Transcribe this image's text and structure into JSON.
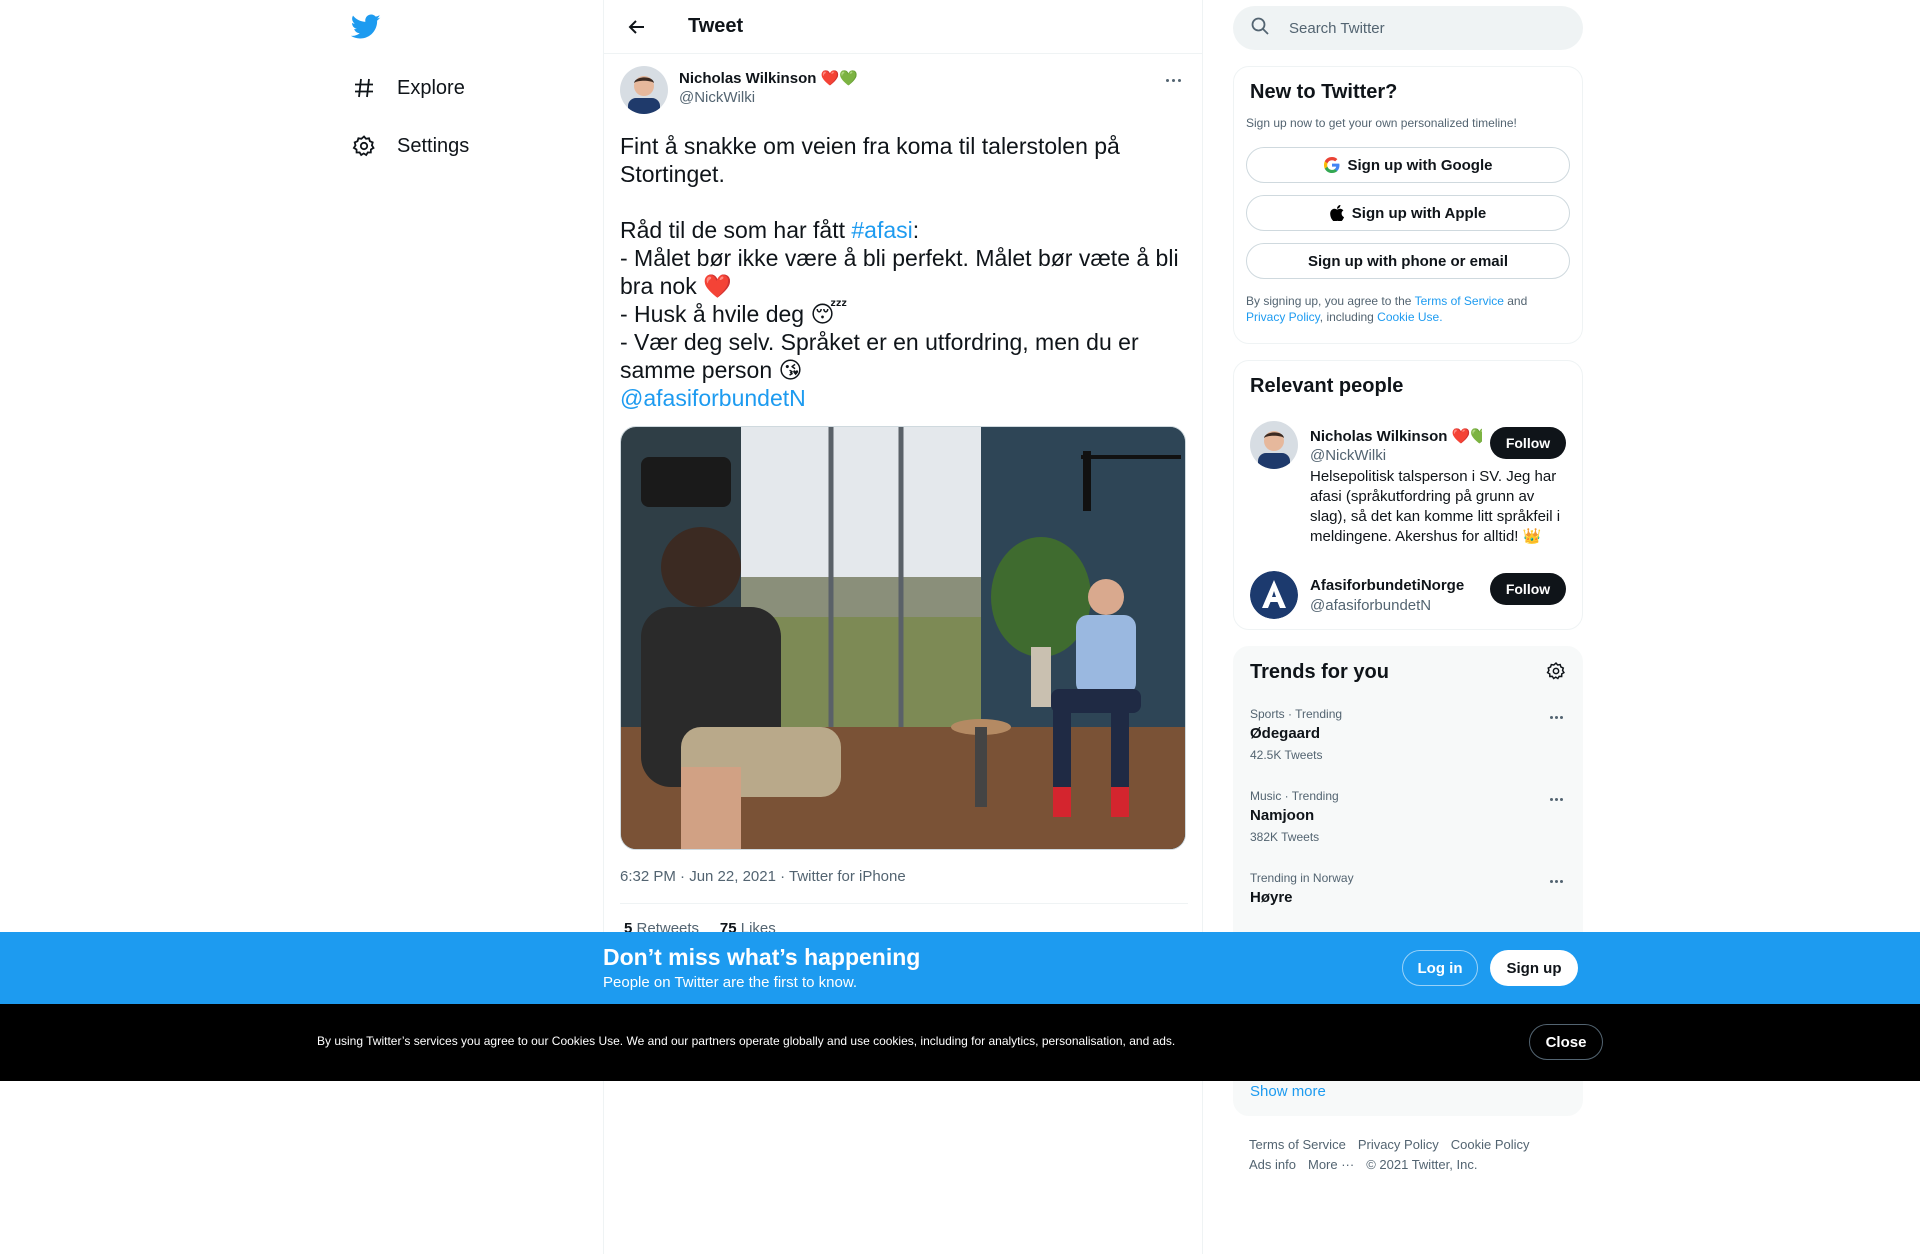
{
  "nav": {
    "items": [
      {
        "label": "Explore",
        "icon": "hashtag-icon"
      },
      {
        "label": "Settings",
        "icon": "gear-icon"
      }
    ]
  },
  "header": {
    "title": "Tweet"
  },
  "tweet": {
    "author_name": "Nicholas Wilkinson ❤️💚",
    "author_handle": "@NickWilki",
    "lines": [
      "Fint å snakke om veien fra koma til talerstolen på Stortinget.",
      "",
      "Råd til de som har fått ",
      "- Målet bør ikke være å bli perfekt. Målet bør væte å bli bra nok ❤️",
      "- Husk å hvile deg 😴",
      "- Vær deg selv. Språket er en utfordring, men du er samme person 😘"
    ],
    "hashtag": "#afasi",
    "hashtag_suffix": ":",
    "mention": "@afasiforbundetN",
    "meta": "6:32 PM · Jun 22, 2021 · Twitter for iPhone",
    "retweets_count": "5",
    "retweets_label": "Retweets",
    "likes_count": "75",
    "likes_label": "Likes"
  },
  "search": {
    "placeholder": "Search Twitter"
  },
  "new_to_twitter": {
    "title": "New to Twitter?",
    "subtitle": "Sign up now to get your own personalized timeline!",
    "google_label": "Sign up with Google",
    "apple_label": "Sign up with Apple",
    "phone_label": "Sign up with phone or email",
    "legal_1": "By signing up, you agree to the ",
    "terms_link": "Terms of Service",
    "legal_2": " and ",
    "privacy_link": "Privacy Policy",
    "legal_3": ", including ",
    "cookie_link": "Cookie Use."
  },
  "relevant_people": {
    "title": "Relevant people",
    "people": [
      {
        "name": "Nicholas Wilkinson ❤️💚",
        "handle": "@NickWilki",
        "bio": "Helsepolitisk talsperson i SV. Jeg har afasi (språkutfordring på grunn av slag), så det kan komme litt språkfeil i meldingene. Akershus for alltid! 👑",
        "follow_label": "Follow"
      },
      {
        "name": "AfasiforbundetiNorge",
        "handle": "@afasiforbundetN",
        "follow_label": "Follow"
      }
    ]
  },
  "trends": {
    "title": "Trends for you",
    "items": [
      {
        "context": "Sports · Trending",
        "name": "Ødegaard",
        "count": "42.5K Tweets"
      },
      {
        "context": "Music · Trending",
        "name": "Namjoon",
        "count": "382K Tweets"
      },
      {
        "context": "Trending in Norway",
        "name": "Høyre",
        "count": ""
      }
    ],
    "show_more": "Show more"
  },
  "footer": {
    "links": [
      "Terms of Service",
      "Privacy Policy",
      "Cookie Policy",
      "Ads info",
      "More ···"
    ],
    "copyright": "© 2021 Twitter, Inc."
  },
  "banner": {
    "title": "Don’t miss what’s happening",
    "subtitle": "People on Twitter are the first to know.",
    "login_label": "Log in",
    "signup_label": "Sign up"
  },
  "cookie": {
    "text": "By using Twitter’s services you agree to our Cookies Use. We and our partners operate globally and use cookies, including for analytics, personalisation, and ads.",
    "close_label": "Close"
  },
  "colors": {
    "accent": "#1d9bf0",
    "text": "#0f1419",
    "muted": "#536471"
  }
}
